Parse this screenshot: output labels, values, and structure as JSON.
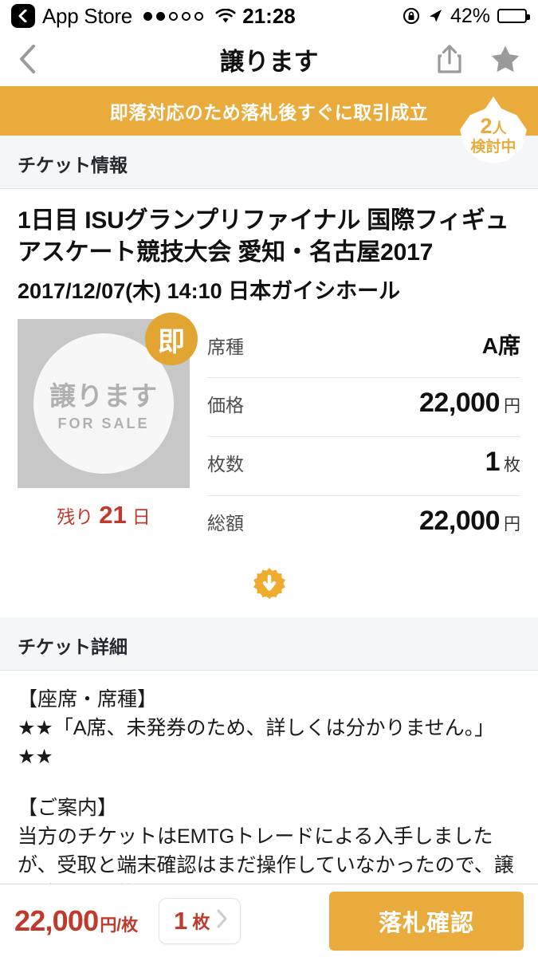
{
  "status_bar": {
    "back_app": "App Store",
    "signal_filled": 2,
    "signal_total": 5,
    "wifi_icon": "wifi-icon",
    "time": "21:28",
    "rotation_lock_icon": "rotation-lock-icon",
    "location_icon": "location-arrow-icon",
    "battery_percent": "42%",
    "battery_level": 42
  },
  "nav": {
    "back_icon": "chevron-left-icon",
    "title": "譲ります",
    "share_icon": "share-icon",
    "favorite_icon": "star-icon"
  },
  "banner": {
    "text": "即落対応のため落札後すぐに取引成立",
    "badge_count": "2",
    "badge_unit": "人",
    "badge_sub": "検討中",
    "color": "#e9ab3b"
  },
  "sections": {
    "ticket_info_header": "チケット情報",
    "ticket_detail_header": "チケット詳細"
  },
  "event": {
    "title": "1日目 ISUグランプリファイナル 国際フィギュアスケート競技大会 愛知・名古屋2017",
    "datetime_venue": "2017/12/07(木) 14:10 日本ガイシホール"
  },
  "thumbnail": {
    "label_jp": "譲ります",
    "label_en": "FOR SALE",
    "instant_badge": "即",
    "remaining_prefix": "残り",
    "remaining_days": "21",
    "remaining_suffix": "日",
    "remaining_color": "#c0392b"
  },
  "details": [
    {
      "label": "席種",
      "value": "A席",
      "unit": "",
      "type": "seat"
    },
    {
      "label": "価格",
      "value": "22,000",
      "unit": "円",
      "type": "amount"
    },
    {
      "label": "枚数",
      "value": "1",
      "unit": "枚",
      "type": "amount"
    },
    {
      "label": "総額",
      "value": "22,000",
      "unit": "円",
      "type": "amount"
    }
  ],
  "expand": {
    "icon": "down-arrow-burst-icon"
  },
  "description": {
    "heading1": "【座席・席種】",
    "line1": "★★「A席、未発券のため、詳しくは分かりません。」",
    "line2": "★★",
    "heading2": "【ご案内】",
    "line3": "当方のチケットはEMTGトレードによる入手しましたが、受取と端末確認はまだ操作していなかったので、譲り渡しは可能だと思います。"
  },
  "bottom_bar": {
    "price": "22,000",
    "price_unit": "円/枚",
    "qty_value": "1",
    "qty_unit": "枚",
    "qty_chevron_icon": "chevron-right-icon",
    "cta_label": "落札確認",
    "cta_color": "#e9ab3b"
  }
}
